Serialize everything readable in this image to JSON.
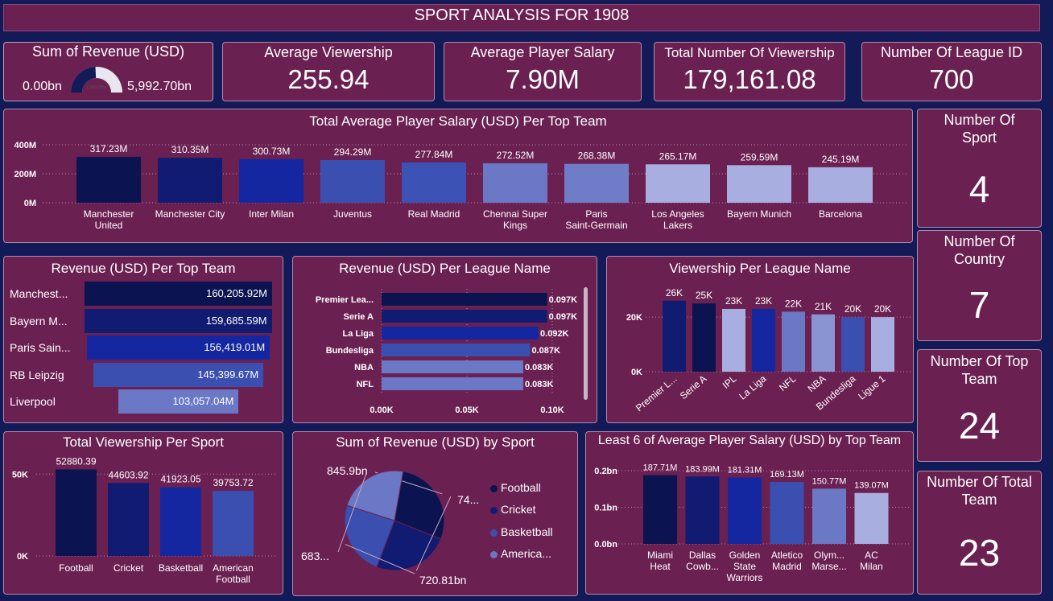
{
  "header": {
    "title": "SPORT ANALYSIS FOR 1908"
  },
  "kpis": {
    "revenue": {
      "label": "Sum of Revenue (USD)",
      "min": "0.00bn",
      "max": "5,992.70bn",
      "gauge_center": "2,906.00bn",
      "fraction": 0.485
    },
    "viewership": {
      "label": "Average Viewership",
      "value": "255.94"
    },
    "salary": {
      "label": "Average Player Salary",
      "value": "7.90M"
    },
    "total_viewership": {
      "label": "Total Number Of Viewership",
      "value": "179,161.08"
    },
    "league": {
      "label": "Number Of League ID",
      "value": "700"
    }
  },
  "side": [
    {
      "label": "Number Of Sport",
      "value": "4"
    },
    {
      "label": "Number Of Country",
      "value": "7"
    },
    {
      "label": "Number Of Top Team",
      "value": "24"
    },
    {
      "label": "Number Of Total Team",
      "value": "23"
    }
  ],
  "colors": {
    "bg": "#121a58",
    "card": "#6b2052",
    "c1": "#0b1450",
    "c2": "#111b72",
    "c3": "#1527a0",
    "c4": "#3a4fb0",
    "c5": "#6a78c6",
    "c6": "#8a94d2",
    "c7": "#a8aedf"
  },
  "chart_data": [
    {
      "id": "salary_top_team",
      "type": "bar",
      "title": "Total Average Player Salary (USD) Per Top Team",
      "categories": [
        "Manchester United",
        "Manchester City",
        "Inter Milan",
        "Juventus",
        "Real Madrid",
        "Chennai Super Kings",
        "Paris Saint-Germain",
        "Los Angeles Lakers",
        "Bayern Munich",
        "Barcelona"
      ],
      "category_lines": [
        [
          "Manchester",
          "United"
        ],
        [
          "Manchester City"
        ],
        [
          "Inter Milan"
        ],
        [
          "Juventus"
        ],
        [
          "Real Madrid"
        ],
        [
          "Chennai Super",
          "Kings"
        ],
        [
          "Paris",
          "Saint-Germain"
        ],
        [
          "Los Angeles",
          "Lakers"
        ],
        [
          "Bayern Munich"
        ],
        [
          "Barcelona"
        ]
      ],
      "values": [
        317.23,
        310.35,
        300.73,
        294.29,
        277.84,
        272.52,
        268.38,
        265.17,
        259.59,
        245.19
      ],
      "labels": [
        "317.23M",
        "310.35M",
        "300.73M",
        "294.29M",
        "277.84M",
        "272.52M",
        "268.38M",
        "265.17M",
        "259.59M",
        "245.19M"
      ],
      "ylim": [
        0,
        400
      ],
      "yticks": [
        {
          "v": 400,
          "t": "400M"
        },
        {
          "v": 200,
          "t": "200M"
        },
        {
          "v": 0,
          "t": "0M"
        }
      ],
      "colors": [
        "#0b1450",
        "#111b72",
        "#1527a0",
        "#3a4fb0",
        "#3d52b5",
        "#6a78c6",
        "#6f7cc8",
        "#a8aedf",
        "#a8aedf",
        "#a8aedf"
      ]
    },
    {
      "id": "revenue_top_team",
      "type": "bar",
      "orientation": "horizontal",
      "title": "Revenue (USD) Per Top Team",
      "categories": [
        "Manchest...",
        "Bayern M...",
        "Paris Sain...",
        "RB Leipzig",
        "Liverpool"
      ],
      "values": [
        160205.92,
        159685.59,
        156419.01,
        145399.67,
        103057.04
      ],
      "labels": [
        "160,205.92M",
        "159,685.59M",
        "156,419.01M",
        "145,399.67M",
        "103,057.04M"
      ],
      "colors": [
        "#0b1450",
        "#111b72",
        "#1527a0",
        "#3a4fb0",
        "#6a78c6"
      ]
    },
    {
      "id": "revenue_league",
      "type": "bar",
      "orientation": "horizontal",
      "title": "Revenue (USD) Per League Name",
      "categories": [
        "Premier Lea...",
        "Serie A",
        "La Liga",
        "Bundesliga",
        "NBA",
        "NFL"
      ],
      "values": [
        0.097,
        0.097,
        0.092,
        0.087,
        0.083,
        0.083
      ],
      "labels": [
        "0.097K",
        "0.097K",
        "0.092K",
        "0.087K",
        "0.083K",
        "0.083K"
      ],
      "xlim": [
        0,
        0.1
      ],
      "xticks": [
        {
          "v": 0,
          "t": "0.00K"
        },
        {
          "v": 0.05,
          "t": "0.05K"
        },
        {
          "v": 0.1,
          "t": "0.10K"
        }
      ],
      "colors": [
        "#0b1450",
        "#111b72",
        "#1527a0",
        "#3a4fb0",
        "#6a78c6",
        "#6a78c6"
      ]
    },
    {
      "id": "viewership_league",
      "type": "bar",
      "title": "Viewership Per League Name",
      "categories": [
        "Premier L...",
        "Serie A",
        "IPL",
        "La Liga",
        "NFL",
        "NBA",
        "Bundesliga",
        "Ligue 1"
      ],
      "values": [
        26,
        25,
        23,
        23,
        22,
        21,
        20,
        20
      ],
      "labels": [
        "26K",
        "25K",
        "23K",
        "23K",
        "22K",
        "21K",
        "20K",
        "20K"
      ],
      "ylim": [
        0,
        28
      ],
      "yticks": [
        {
          "v": 20,
          "t": "20K"
        },
        {
          "v": 0,
          "t": "0K"
        }
      ],
      "colors": [
        "#111b72",
        "#0b1450",
        "#a8aedf",
        "#1527a0",
        "#6a78c6",
        "#8a94d2",
        "#3a4fb0",
        "#a8aedf"
      ]
    },
    {
      "id": "viewership_sport",
      "type": "bar",
      "title": "Total Viewership Per Sport",
      "categories": [
        "Football",
        "Cricket",
        "Basketball",
        "American Football"
      ],
      "category_lines": [
        [
          "Football"
        ],
        [
          "Cricket"
        ],
        [
          "Basketball"
        ],
        [
          "American",
          "Football"
        ]
      ],
      "values": [
        52880.39,
        44603.92,
        41923.05,
        39753.72
      ],
      "labels": [
        "52880.39",
        "44603.92",
        "41923.05",
        "39753.72"
      ],
      "ylim": [
        0,
        58000
      ],
      "yticks": [
        {
          "v": 50000,
          "t": "50K"
        },
        {
          "v": 0,
          "t": "0K"
        }
      ],
      "colors": [
        "#0b1450",
        "#111b72",
        "#1527a0",
        "#3a4fb0"
      ]
    },
    {
      "id": "revenue_sport",
      "type": "pie",
      "title": "Sum of Revenue (USD) by Sport",
      "categories": [
        "Football",
        "Cricket",
        "Basketball",
        "America..."
      ],
      "values": [
        845.9,
        740,
        720.81,
        683
      ],
      "labels": [
        "845.9bn",
        "74...",
        "720.81bn",
        "683..."
      ],
      "colors": [
        "#0b1450",
        "#111b72",
        "#3a4fb0",
        "#6a78c6"
      ]
    },
    {
      "id": "least_salary",
      "type": "bar",
      "title": "Least 6 of Average Player Salary (USD) by Top Team",
      "categories": [
        "Miami Heat",
        "Dallas Cowb...",
        "Golden State Warriors",
        "Atletico Madrid",
        "Olym... Marse...",
        "AC Milan"
      ],
      "category_lines": [
        [
          "Miami",
          "Heat"
        ],
        [
          "Dallas",
          "Cowb..."
        ],
        [
          "Golden",
          "State",
          "Warriors"
        ],
        [
          "Atletico",
          "Madrid"
        ],
        [
          "Olym...",
          "Marse..."
        ],
        [
          "AC",
          "Milan"
        ]
      ],
      "values": [
        187.71,
        183.99,
        181.31,
        169.13,
        150.77,
        139.07
      ],
      "labels": [
        "187.71M",
        "183.99M",
        "181.31M",
        "169.13M",
        "150.77M",
        "139.07M"
      ],
      "ylim": [
        0,
        200
      ],
      "yticks": [
        {
          "v": 200,
          "t": "0.2bn"
        },
        {
          "v": 100,
          "t": "0.1bn"
        },
        {
          "v": 0,
          "t": "0.0bn"
        }
      ],
      "colors": [
        "#0b1450",
        "#111b72",
        "#1527a0",
        "#3a4fb0",
        "#6a78c6",
        "#a8aedf"
      ]
    }
  ]
}
